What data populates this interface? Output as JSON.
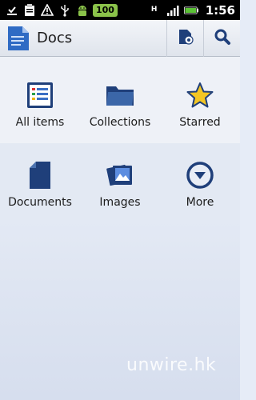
{
  "status_bar": {
    "battery_level": "100",
    "network_type": "H",
    "clock": "1:56",
    "icons": [
      "download-complete-icon",
      "clipboard-icon",
      "warning-icon",
      "usb-icon",
      "android-icon",
      "network-icon",
      "signal-icon",
      "battery-icon"
    ]
  },
  "action_bar": {
    "title": "Docs",
    "actions": [
      "new-document-icon",
      "search-icon"
    ]
  },
  "grid": {
    "items": [
      {
        "label": "All items",
        "icon": "all-items-icon"
      },
      {
        "label": "Collections",
        "icon": "folder-icon"
      },
      {
        "label": "Starred",
        "icon": "star-icon"
      },
      {
        "label": "Documents",
        "icon": "document-icon"
      },
      {
        "label": "Images",
        "icon": "images-icon"
      },
      {
        "label": "More",
        "icon": "more-icon"
      }
    ]
  },
  "watermark": "unwire.hk",
  "colors": {
    "status_bar_bg": "#000000",
    "battery_badge": "#8bc34a",
    "page_bg": "#e6ecf7",
    "icon_blue": "#1f3f7a",
    "star_yellow": "#f3c623"
  }
}
